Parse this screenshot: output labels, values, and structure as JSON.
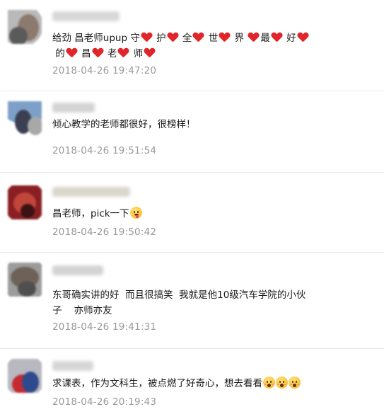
{
  "comments": [
    {
      "segments": [
        {
          "t": "text",
          "v": "给劲 昌老师upup 守"
        },
        {
          "t": "heart"
        },
        {
          "t": "text",
          "v": " 护"
        },
        {
          "t": "heart"
        },
        {
          "t": "text",
          "v": " 全"
        },
        {
          "t": "heart"
        },
        {
          "t": "text",
          "v": " 世"
        },
        {
          "t": "heart"
        },
        {
          "t": "text",
          "v": " 界 "
        },
        {
          "t": "heart"
        },
        {
          "t": "text",
          "v": "最"
        },
        {
          "t": "heart"
        },
        {
          "t": "text",
          "v": " 好"
        },
        {
          "t": "heart"
        },
        {
          "t": "br"
        },
        {
          "t": "text",
          "v": " 的"
        },
        {
          "t": "heart"
        },
        {
          "t": "text",
          "v": " 昌"
        },
        {
          "t": "heart"
        },
        {
          "t": "text",
          "v": " 老"
        },
        {
          "t": "heart"
        },
        {
          "t": "text",
          "v": " 师"
        },
        {
          "t": "heart"
        }
      ],
      "time": "2018-04-26 19:47:20"
    },
    {
      "segments": [
        {
          "t": "text",
          "v": "倾心教学的老师都很好，很榜样！"
        }
      ],
      "time": "2018-04-26 19:51:54"
    },
    {
      "segments": [
        {
          "t": "text",
          "v": "昌老师，pick一下"
        },
        {
          "t": "emoji",
          "v": "tongue"
        }
      ],
      "time": "2018-04-26 19:50:42"
    },
    {
      "segments": [
        {
          "t": "text",
          "v": "东哥确实讲的好  而且很搞笑  我就是他10级汽车学院的小伙"
        },
        {
          "t": "br"
        },
        {
          "t": "text",
          "v": "子    亦师亦友"
        }
      ],
      "time": "2018-04-26 19:41:31"
    },
    {
      "segments": [
        {
          "t": "text",
          "v": "求课表，作为文科生，被点燃了好奇心，想去看看"
        },
        {
          "t": "emoji",
          "v": "wow"
        },
        {
          "t": "emoji",
          "v": "wow"
        },
        {
          "t": "emoji",
          "v": "wow"
        }
      ],
      "time": "2018-04-26 20:19:43"
    }
  ],
  "colors": {
    "heart": "#e0262a",
    "timestamp": "#999999",
    "divider": "#e8e8e8"
  }
}
